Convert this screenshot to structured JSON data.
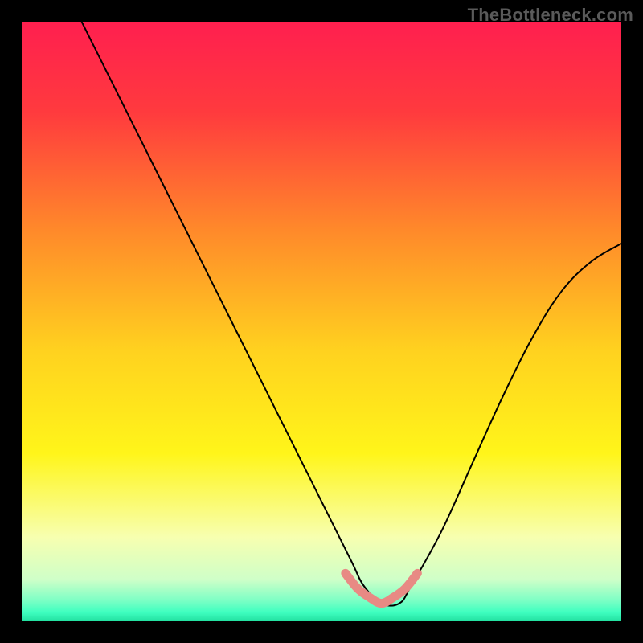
{
  "watermark": "TheBottleneck.com",
  "chart_data": {
    "type": "line",
    "title": "",
    "xlabel": "",
    "ylabel": "",
    "xlim": [
      0,
      100
    ],
    "ylim": [
      0,
      100
    ],
    "grid": false,
    "legend": false,
    "background_gradient": {
      "stops": [
        {
          "pos": 0.0,
          "color": "#ff1f4f"
        },
        {
          "pos": 0.15,
          "color": "#ff3a3e"
        },
        {
          "pos": 0.35,
          "color": "#ff8a2a"
        },
        {
          "pos": 0.55,
          "color": "#ffd21f"
        },
        {
          "pos": 0.72,
          "color": "#fff51a"
        },
        {
          "pos": 0.86,
          "color": "#f7ffb0"
        },
        {
          "pos": 0.93,
          "color": "#cfffc8"
        },
        {
          "pos": 0.965,
          "color": "#7dffc5"
        },
        {
          "pos": 0.985,
          "color": "#3fffc0"
        },
        {
          "pos": 1.0,
          "color": "#22e0a0"
        }
      ]
    },
    "series": [
      {
        "name": "bottleneck-curve",
        "color": "#000000",
        "stroke_width": 2,
        "x": [
          10,
          15,
          20,
          25,
          30,
          35,
          40,
          45,
          50,
          55,
          57,
          60,
          63,
          65,
          70,
          75,
          80,
          85,
          90,
          95,
          100
        ],
        "y": [
          100,
          90,
          80,
          70,
          60,
          50,
          40,
          30,
          20,
          10,
          6,
          3,
          3,
          6,
          15,
          26,
          37,
          47,
          55,
          60,
          63
        ]
      }
    ],
    "highlight": {
      "name": "optimal-range",
      "color": "#e88a84",
      "stroke_width": 11,
      "x": [
        54,
        56,
        58,
        60,
        62,
        64,
        66
      ],
      "y": [
        8,
        5.5,
        4,
        3,
        4,
        5.5,
        8
      ]
    }
  }
}
